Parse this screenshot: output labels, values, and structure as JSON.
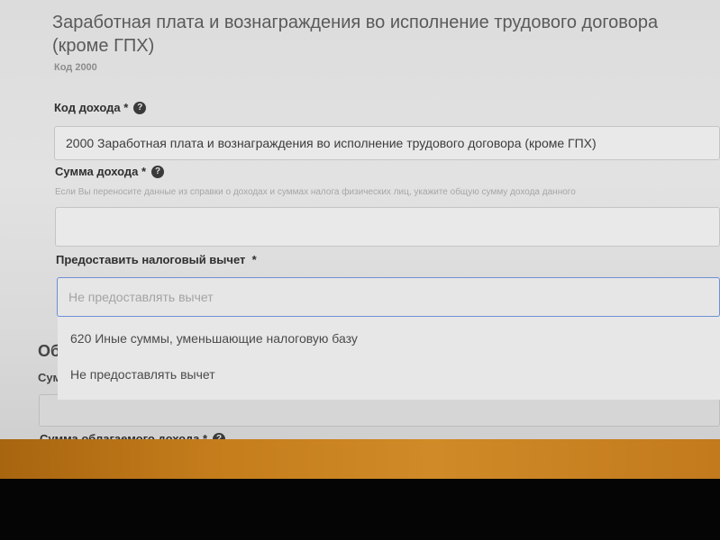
{
  "header": {
    "title": "Заработная плата и вознаграждения во исполнение трудового договора (кроме ГПХ)",
    "code_caption": "Код 2000"
  },
  "income_code": {
    "label": "Код дохода *",
    "value": "2000 Заработная плата и вознаграждения во исполнение трудового договора (кроме ГПХ)"
  },
  "income_amount": {
    "label": "Сумма дохода *",
    "hint": "Если Вы переносите данные из справки о доходах и суммах налога физических лиц, укажите общую сумму дохода данного",
    "value": ""
  },
  "deduction": {
    "label": "Предоставить налоговый вычет  *",
    "placeholder": "Не предоставлять вычет",
    "options": [
      "620 Иные суммы, уменьшающие налоговую базу",
      "Не предоставлять вычет"
    ]
  },
  "background_section": {
    "heading_fragment": "Об",
    "label_fragment": "Сум",
    "taxable_label": "Сумма облагаемого дохода *"
  }
}
